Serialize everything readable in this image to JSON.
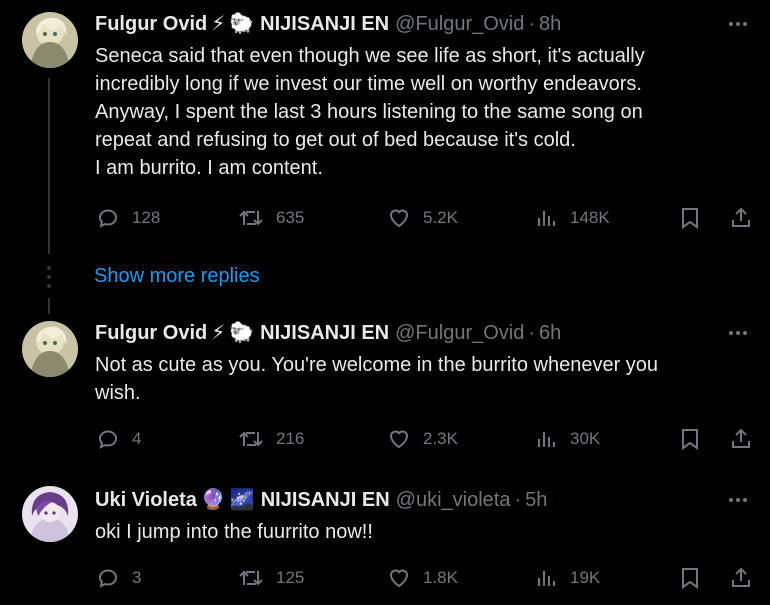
{
  "tweets": [
    {
      "name": "Fulgur Ovid",
      "emojis": [
        "⚡",
        "🐑"
      ],
      "org": "NIJISANJI EN",
      "handle": "@Fulgur_Ovid",
      "time": "8h",
      "lines": [
        "Seneca said that even though we see life as short, it's actually",
        "incredibly long if we invest our time well on worthy endeavors.",
        "Anyway, I spent the last 3 hours listening to the same song on",
        "repeat and refusing to get out of bed because it's cold.",
        "I am burrito. I am content."
      ],
      "replies": "128",
      "retweets": "635",
      "likes": "5.2K",
      "views": "148K"
    },
    {
      "name": "Fulgur Ovid",
      "emojis": [
        "⚡",
        "🐑"
      ],
      "org": "NIJISANJI EN",
      "handle": "@Fulgur_Ovid",
      "time": "6h",
      "lines": [
        "Not as cute as you. You're welcome in the burrito whenever you",
        "wish."
      ],
      "replies": "4",
      "retweets": "216",
      "likes": "2.3K",
      "views": "30K"
    },
    {
      "name": "Uki Violeta",
      "emojis": [
        "🔮",
        "🌌"
      ],
      "org": "NIJISANJI EN",
      "handle": "@uki_violeta",
      "time": "5h",
      "lines": [
        "oki I jump into the fuurrito now!!"
      ],
      "replies": "3",
      "retweets": "125",
      "likes": "1.8K",
      "views": "19K"
    }
  ],
  "show_more_replies": "Show more replies",
  "separator": "·",
  "colors": {
    "background": "#000000",
    "text": "#e7e9ea",
    "muted": "#71767b",
    "link": "#1d9bf0",
    "line": "#333639"
  }
}
